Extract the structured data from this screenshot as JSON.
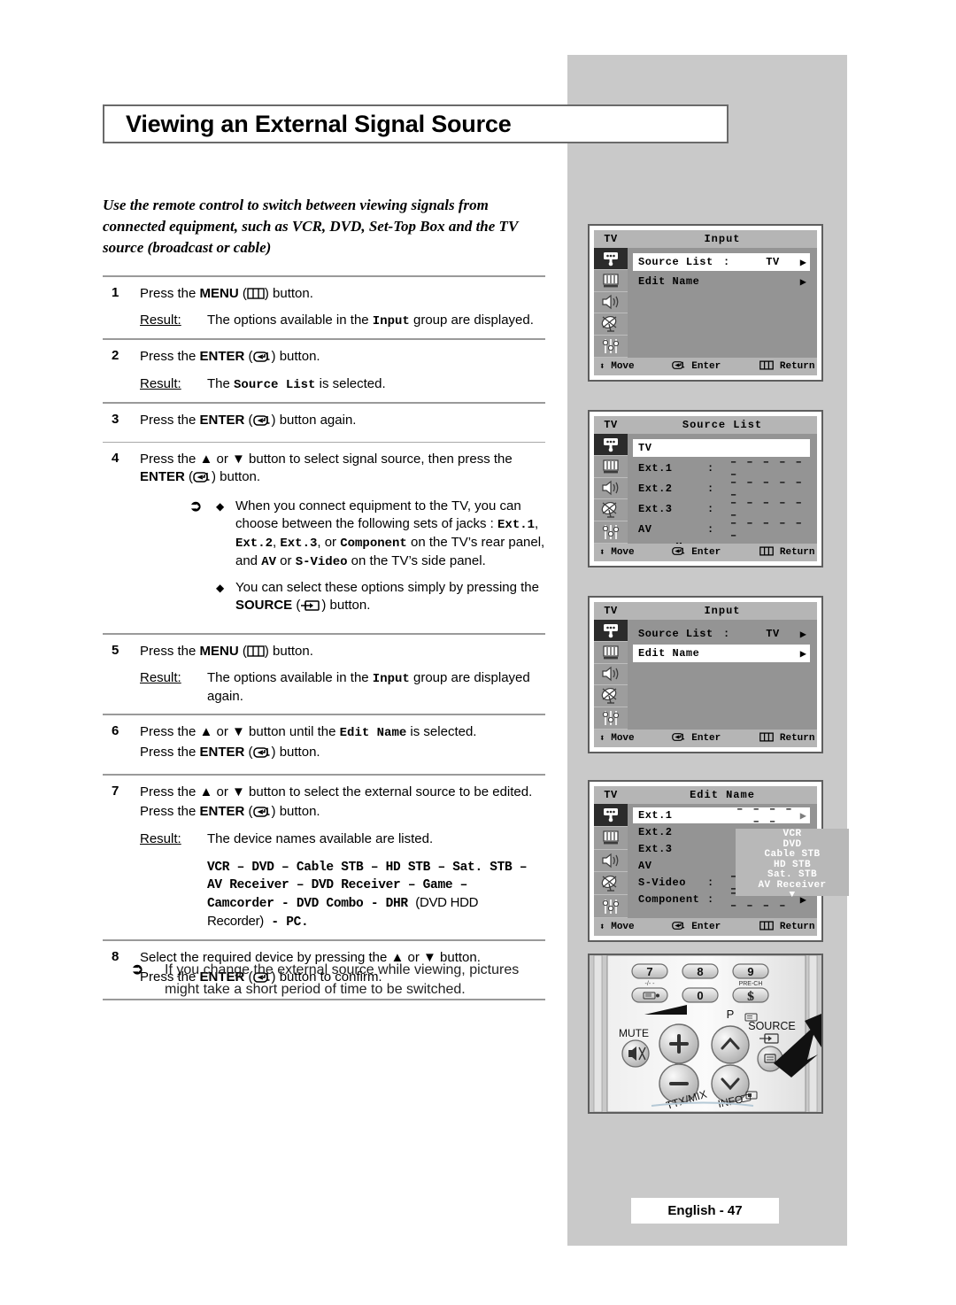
{
  "page": {
    "title": "Viewing an External Signal Source",
    "intro": "Use the remote control to switch between viewing signals from connected equipment, such as VCR, DVD, Set-Top Box and the TV source (broadcast or cable)",
    "footer": "English - 47"
  },
  "steps": [
    {
      "num": "1",
      "line1_a": "Press the ",
      "line1_b": "MENU",
      "line1_c": " (",
      "line1_d": ") button.",
      "icon": "menu-icon",
      "result_label": "Result:",
      "result_a": "The options available in the ",
      "result_mono": "Input",
      "result_b": " group are displayed."
    },
    {
      "num": "2",
      "line1_a": "Press the ",
      "line1_b": "ENTER",
      "line1_c": " (",
      "line1_d": ") button.",
      "icon": "enter-icon",
      "result_label": "Result:",
      "result_a": "The ",
      "result_mono": "Source List",
      "result_b": " is selected."
    },
    {
      "num": "3",
      "line1_a": "Press the ",
      "line1_b": "ENTER",
      "line1_c": " (",
      "line1_d": ") button again.",
      "icon": "enter-icon"
    },
    {
      "num": "4",
      "line1_a": "Press the ▲ or ▼ button to select signal source, then press the ",
      "line1_b": "ENTER",
      "line1_c": " (",
      "line1_d": ") button.",
      "icon": "enter-icon",
      "notes": [
        {
          "p1": "When you connect equipment to the TV, you can choose between the following sets of jacks : ",
          "m1": "Ext.1",
          "p2": ", ",
          "m2": "Ext.2",
          "p3": ", ",
          "m3": "Ext.3",
          "p4": ", or ",
          "m4": "Component",
          "p5": " on the TV’s rear panel, and ",
          "m5": "AV",
          "p6": " or ",
          "m6": "S-Video",
          "p7": " on the TV’s side panel."
        },
        {
          "p1": "You can select these options simply by pressing the ",
          "b1": "SOURCE",
          "p2": " (",
          "p3": ") button."
        }
      ]
    },
    {
      "num": "5",
      "line1_a": "Press the ",
      "line1_b": "MENU",
      "line1_c": " (",
      "line1_d": ") button.",
      "icon": "menu-icon",
      "result_label": "Result:",
      "result_a": "The options available in the ",
      "result_mono": "Input",
      "result_b": " group are displayed again."
    },
    {
      "num": "6",
      "line1_a": "Press the ▲ or ▼ button until the ",
      "line1_mono": "Edit Name",
      "line1_tail": " is selected.",
      "line2_a": "Press the ",
      "line2_b": "ENTER",
      "line2_c": " (",
      "line2_d": ") button.",
      "icon": "enter-icon"
    },
    {
      "num": "7",
      "line1_a": "Press the ▲ or ▼ button to select the external source to be edited.",
      "line2_a": "Press the ",
      "line2_b": "ENTER",
      "line2_c": " (",
      "line2_d": ") button.",
      "icon": "enter-icon",
      "result_label": "Result:",
      "result_a": "The device names available are listed.",
      "device_list_line1": "VCR –  DVD – Cable STB – HD STB –  Sat. STB –",
      "device_list_line2": "AV Receiver – DVD Receiver – Game –",
      "device_list_line3": "Camcorder - DVD Combo - DHR ",
      "device_list_line3b": "(DVD HDD",
      "device_list_line4": "Recorder)",
      "device_list_line4b": " - PC."
    },
    {
      "num": "8",
      "line1_a": "Select the required device by pressing the ▲ or ▼ button.",
      "line2_a": "Press the ",
      "line2_b": "ENTER",
      "line2_c": " (",
      "line2_d": ") button to confirm.",
      "icon": "enter-icon"
    }
  ],
  "footnote": {
    "arrow": "➢",
    "text": "If you change the external source while viewing, pictures might take a short period of time to be switched."
  },
  "osd_common": {
    "tv_label": "TV",
    "bottom": {
      "move": "Move",
      "enter": "Enter",
      "return": "Return"
    },
    "sidebar_icons": [
      "input-plug-icon",
      "picture-icon",
      "sound-speaker-icon",
      "channel-dish-icon",
      "setup-sliders-icon"
    ]
  },
  "osd_panels": [
    {
      "name": "input-menu-1",
      "title": "Input",
      "rows": [
        {
          "label": "Source List",
          "colon": ":",
          "value": "TV",
          "arrow": "▶",
          "highlight": true
        },
        {
          "label": "Edit Name",
          "colon": "",
          "value": "",
          "arrow": "▶",
          "highlight": false
        }
      ]
    },
    {
      "name": "source-list-menu",
      "title": "Source List",
      "rows": [
        {
          "label": "TV",
          "colon": "",
          "dashes": "",
          "highlight": true
        },
        {
          "label": "Ext.1",
          "colon": ":",
          "dashes": "– – – – – –",
          "highlight": false
        },
        {
          "label": "Ext.2",
          "colon": ":",
          "dashes": "– – – – – –",
          "highlight": false
        },
        {
          "label": "Ext.3",
          "colon": ":",
          "dashes": "– – – – – –",
          "highlight": false
        },
        {
          "label": "AV",
          "colon": ":",
          "dashes": "– – – – – –",
          "highlight": false
        }
      ],
      "more": "▼ More"
    },
    {
      "name": "input-menu-2",
      "title": "Input",
      "rows": [
        {
          "label": "Source List",
          "colon": ":",
          "value": "TV",
          "arrow": "▶",
          "highlight": false
        },
        {
          "label": "Edit Name",
          "colon": "",
          "value": "",
          "arrow": "▶",
          "highlight": true
        }
      ]
    },
    {
      "name": "edit-name-menu",
      "title": "Edit Name",
      "rows": [
        {
          "label": "Ext.1",
          "colon": "",
          "dashes": "– – – – – –",
          "arrow": "▶",
          "highlight": true,
          "dim": true
        },
        {
          "label": "Ext.2",
          "colon": "",
          "dashes": "",
          "arrow": "▶",
          "highlight": false
        },
        {
          "label": "Ext.3",
          "colon": "",
          "dashes": "",
          "arrow": "▶",
          "highlight": false
        },
        {
          "label": "AV",
          "colon": "",
          "dashes": "",
          "arrow": "▶",
          "highlight": false
        },
        {
          "label": "S-Video",
          "colon": ":",
          "dashes": "– – – – – – – –",
          "arrow": "▶",
          "highlight": false
        },
        {
          "label": "Component",
          "colon": ":",
          "dashes": "– – – – – – – –",
          "arrow": "▶",
          "highlight": false
        }
      ],
      "dropdown": [
        "VCR",
        "DVD",
        "Cable STB",
        "HD STB",
        "Sat. STB",
        "AV Receiver"
      ],
      "dropdown_more": "▼"
    }
  ],
  "remote": {
    "keys": [
      "7",
      "8",
      "9",
      "0"
    ],
    "labels": {
      "dash_slash": "-/- -",
      "prech": "PRE-CH",
      "mute": "MUTE",
      "p": "P",
      "source": "SOURCE",
      "ttx": "TTX/MIX",
      "info": "INFO"
    },
    "icons": [
      "teletext-icon",
      "currency-icon",
      "mute-icon",
      "volume-up-icon",
      "volume-down-icon",
      "channel-up-icon",
      "channel-down-icon",
      "source-icon",
      "pointer-arrow-icon"
    ]
  }
}
